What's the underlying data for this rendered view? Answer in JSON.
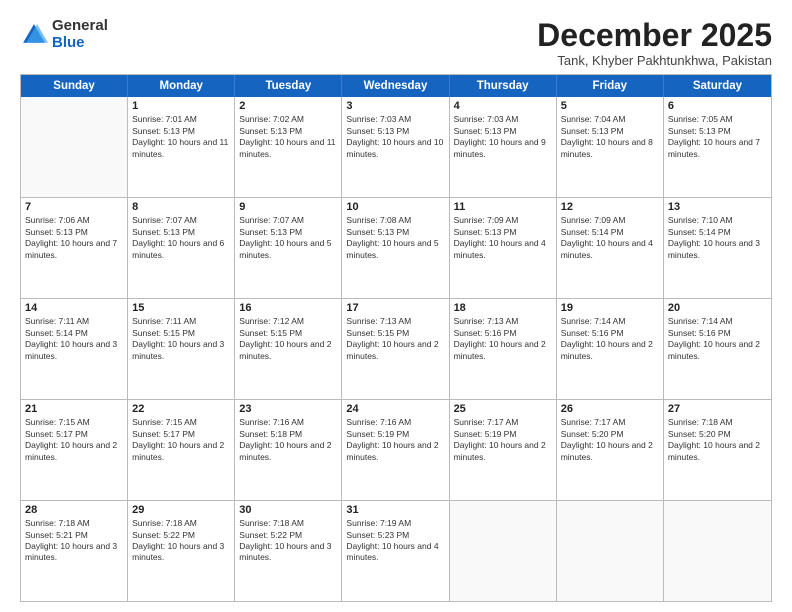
{
  "logo": {
    "general": "General",
    "blue": "Blue"
  },
  "title": "December 2025",
  "location": "Tank, Khyber Pakhtunkhwa, Pakistan",
  "header_days": [
    "Sunday",
    "Monday",
    "Tuesday",
    "Wednesday",
    "Thursday",
    "Friday",
    "Saturday"
  ],
  "weeks": [
    [
      {
        "day": "",
        "sunrise": "",
        "sunset": "",
        "daylight": ""
      },
      {
        "day": "1",
        "sunrise": "Sunrise: 7:01 AM",
        "sunset": "Sunset: 5:13 PM",
        "daylight": "Daylight: 10 hours and 11 minutes."
      },
      {
        "day": "2",
        "sunrise": "Sunrise: 7:02 AM",
        "sunset": "Sunset: 5:13 PM",
        "daylight": "Daylight: 10 hours and 11 minutes."
      },
      {
        "day": "3",
        "sunrise": "Sunrise: 7:03 AM",
        "sunset": "Sunset: 5:13 PM",
        "daylight": "Daylight: 10 hours and 10 minutes."
      },
      {
        "day": "4",
        "sunrise": "Sunrise: 7:03 AM",
        "sunset": "Sunset: 5:13 PM",
        "daylight": "Daylight: 10 hours and 9 minutes."
      },
      {
        "day": "5",
        "sunrise": "Sunrise: 7:04 AM",
        "sunset": "Sunset: 5:13 PM",
        "daylight": "Daylight: 10 hours and 8 minutes."
      },
      {
        "day": "6",
        "sunrise": "Sunrise: 7:05 AM",
        "sunset": "Sunset: 5:13 PM",
        "daylight": "Daylight: 10 hours and 7 minutes."
      }
    ],
    [
      {
        "day": "7",
        "sunrise": "Sunrise: 7:06 AM",
        "sunset": "Sunset: 5:13 PM",
        "daylight": "Daylight: 10 hours and 7 minutes."
      },
      {
        "day": "8",
        "sunrise": "Sunrise: 7:07 AM",
        "sunset": "Sunset: 5:13 PM",
        "daylight": "Daylight: 10 hours and 6 minutes."
      },
      {
        "day": "9",
        "sunrise": "Sunrise: 7:07 AM",
        "sunset": "Sunset: 5:13 PM",
        "daylight": "Daylight: 10 hours and 5 minutes."
      },
      {
        "day": "10",
        "sunrise": "Sunrise: 7:08 AM",
        "sunset": "Sunset: 5:13 PM",
        "daylight": "Daylight: 10 hours and 5 minutes."
      },
      {
        "day": "11",
        "sunrise": "Sunrise: 7:09 AM",
        "sunset": "Sunset: 5:13 PM",
        "daylight": "Daylight: 10 hours and 4 minutes."
      },
      {
        "day": "12",
        "sunrise": "Sunrise: 7:09 AM",
        "sunset": "Sunset: 5:14 PM",
        "daylight": "Daylight: 10 hours and 4 minutes."
      },
      {
        "day": "13",
        "sunrise": "Sunrise: 7:10 AM",
        "sunset": "Sunset: 5:14 PM",
        "daylight": "Daylight: 10 hours and 3 minutes."
      }
    ],
    [
      {
        "day": "14",
        "sunrise": "Sunrise: 7:11 AM",
        "sunset": "Sunset: 5:14 PM",
        "daylight": "Daylight: 10 hours and 3 minutes."
      },
      {
        "day": "15",
        "sunrise": "Sunrise: 7:11 AM",
        "sunset": "Sunset: 5:15 PM",
        "daylight": "Daylight: 10 hours and 3 minutes."
      },
      {
        "day": "16",
        "sunrise": "Sunrise: 7:12 AM",
        "sunset": "Sunset: 5:15 PM",
        "daylight": "Daylight: 10 hours and 2 minutes."
      },
      {
        "day": "17",
        "sunrise": "Sunrise: 7:13 AM",
        "sunset": "Sunset: 5:15 PM",
        "daylight": "Daylight: 10 hours and 2 minutes."
      },
      {
        "day": "18",
        "sunrise": "Sunrise: 7:13 AM",
        "sunset": "Sunset: 5:16 PM",
        "daylight": "Daylight: 10 hours and 2 minutes."
      },
      {
        "day": "19",
        "sunrise": "Sunrise: 7:14 AM",
        "sunset": "Sunset: 5:16 PM",
        "daylight": "Daylight: 10 hours and 2 minutes."
      },
      {
        "day": "20",
        "sunrise": "Sunrise: 7:14 AM",
        "sunset": "Sunset: 5:16 PM",
        "daylight": "Daylight: 10 hours and 2 minutes."
      }
    ],
    [
      {
        "day": "21",
        "sunrise": "Sunrise: 7:15 AM",
        "sunset": "Sunset: 5:17 PM",
        "daylight": "Daylight: 10 hours and 2 minutes."
      },
      {
        "day": "22",
        "sunrise": "Sunrise: 7:15 AM",
        "sunset": "Sunset: 5:17 PM",
        "daylight": "Daylight: 10 hours and 2 minutes."
      },
      {
        "day": "23",
        "sunrise": "Sunrise: 7:16 AM",
        "sunset": "Sunset: 5:18 PM",
        "daylight": "Daylight: 10 hours and 2 minutes."
      },
      {
        "day": "24",
        "sunrise": "Sunrise: 7:16 AM",
        "sunset": "Sunset: 5:19 PM",
        "daylight": "Daylight: 10 hours and 2 minutes."
      },
      {
        "day": "25",
        "sunrise": "Sunrise: 7:17 AM",
        "sunset": "Sunset: 5:19 PM",
        "daylight": "Daylight: 10 hours and 2 minutes."
      },
      {
        "day": "26",
        "sunrise": "Sunrise: 7:17 AM",
        "sunset": "Sunset: 5:20 PM",
        "daylight": "Daylight: 10 hours and 2 minutes."
      },
      {
        "day": "27",
        "sunrise": "Sunrise: 7:18 AM",
        "sunset": "Sunset: 5:20 PM",
        "daylight": "Daylight: 10 hours and 2 minutes."
      }
    ],
    [
      {
        "day": "28",
        "sunrise": "Sunrise: 7:18 AM",
        "sunset": "Sunset: 5:21 PM",
        "daylight": "Daylight: 10 hours and 3 minutes."
      },
      {
        "day": "29",
        "sunrise": "Sunrise: 7:18 AM",
        "sunset": "Sunset: 5:22 PM",
        "daylight": "Daylight: 10 hours and 3 minutes."
      },
      {
        "day": "30",
        "sunrise": "Sunrise: 7:18 AM",
        "sunset": "Sunset: 5:22 PM",
        "daylight": "Daylight: 10 hours and 3 minutes."
      },
      {
        "day": "31",
        "sunrise": "Sunrise: 7:19 AM",
        "sunset": "Sunset: 5:23 PM",
        "daylight": "Daylight: 10 hours and 4 minutes."
      },
      {
        "day": "",
        "sunrise": "",
        "sunset": "",
        "daylight": ""
      },
      {
        "day": "",
        "sunrise": "",
        "sunset": "",
        "daylight": ""
      },
      {
        "day": "",
        "sunrise": "",
        "sunset": "",
        "daylight": ""
      }
    ]
  ]
}
